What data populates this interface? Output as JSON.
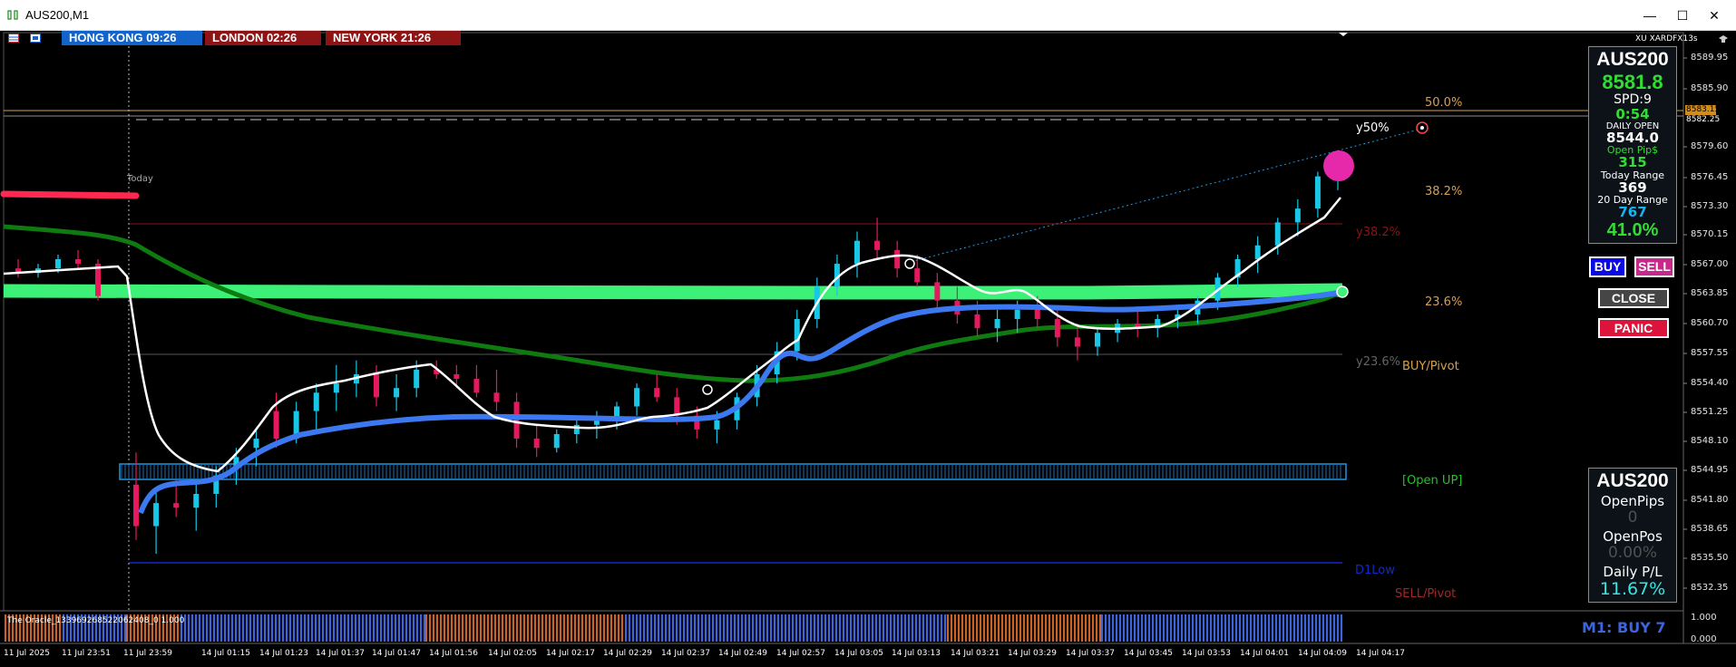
{
  "window": {
    "title": "AUS200,M1",
    "minimize": "—",
    "maximize": "☐",
    "close": "✕"
  },
  "sessions": [
    {
      "label": "HONG KONG 09:26",
      "color": "#1463c8"
    },
    {
      "label": "LONDON  02:26",
      "color": "#8c1414"
    },
    {
      "label": "NEW YORK  21:26",
      "color": "#8c1414"
    }
  ],
  "broker_label": "XU XARDFX13s",
  "info_panel": {
    "symbol": "AUS200",
    "price": "8581.8",
    "spread": "SPD:9",
    "timer": "0:54",
    "daily_open_label": "DAILY OPEN",
    "daily_open": "8544.0",
    "open_pips_label": "Open Pip$",
    "open_pips": "315",
    "today_range_label": "Today Range",
    "today_range": "369",
    "day20_range_label": "20 Day Range",
    "day20_range": "767",
    "ratio": "41.0%"
  },
  "buttons": {
    "buy": "BUY",
    "sell": "SELL",
    "close": "CLOSE",
    "panic": "PANIC"
  },
  "pos_panel": {
    "symbol": "AUS200",
    "open_pips_label": "OpenPips",
    "open_pips": "0",
    "open_pos_label": "OpenPos",
    "open_pos": "0.00%",
    "daily_pl_label": "Daily P/L",
    "daily_pl": "11.67%"
  },
  "fib_labels": {
    "f50": "50.0%",
    "y50": "y50%",
    "f382": "38.2%",
    "y382": "y38.2%",
    "f236": "23.6%",
    "y236": "y23.6%",
    "buy_pivot": "BUY/Pivot",
    "open_up": "[Open UP]",
    "d1low": "D1Low",
    "sell_pivot": "SELL/Pivot",
    "today": "Today"
  },
  "indicator": {
    "name": "The Oracle_133969268522062408_0 1.000",
    "signal": "M1: BUY 7"
  },
  "price_axis": [
    "8589.95",
    "8585.90",
    "8579.60",
    "8576.45",
    "8573.30",
    "8570.15",
    "8567.00",
    "8563.85",
    "8560.70",
    "8557.55",
    "8554.40",
    "8551.25",
    "8548.10",
    "8544.95",
    "8541.80",
    "8538.65",
    "8535.50",
    "8532.35"
  ],
  "price_markers": {
    "upper": "8583.15",
    "lower": "8582.25"
  },
  "ind_axis": [
    "1.000",
    "0.000"
  ],
  "time_axis": [
    "11 Jul 2025",
    "11 Jul 23:51",
    "11 Jul 23:59",
    "14 Jul 01:15",
    "14 Jul 01:23",
    "14 Jul 01:37",
    "14 Jul 01:47",
    "14 Jul 01:56",
    "14 Jul 02:05",
    "14 Jul 02:17",
    "14 Jul 02:29",
    "14 Jul 02:37",
    "14 Jul 02:49",
    "14 Jul 02:57",
    "14 Jul 03:05",
    "14 Jul 03:13",
    "14 Jul 03:21",
    "14 Jul 03:29",
    "14 Jul 03:37",
    "14 Jul 03:45",
    "14 Jul 03:53",
    "14 Jul 04:01",
    "14 Jul 04:09",
    "14 Jul 04:17"
  ],
  "colors": {
    "bull": "#19c6e6",
    "bear": "#e6195f",
    "green_band": "#3cf078",
    "dark_green": "#0f7a0f",
    "blue_ma": "#3c78f0",
    "white_ma": "#ffffff",
    "red_line": "#ff2850",
    "ind_blue": "#3c64dc",
    "ind_orange": "#c86428",
    "fib_orange": "#d7a050"
  },
  "chart_data": {
    "type": "candlestick",
    "symbol": "AUS200",
    "timeframe": "M1",
    "fib_levels": {
      "50.0%": 8583.15,
      "38.2%": 8573.3,
      "23.6%": 8563.85
    },
    "candles": [
      [
        8566.5,
        8567.5,
        8565.5,
        8566.0
      ],
      [
        8566.0,
        8567.0,
        8565.5,
        8566.5
      ],
      [
        8566.5,
        8568.0,
        8566.0,
        8567.5
      ],
      [
        8567.5,
        8568.5,
        8566.5,
        8567.0
      ],
      [
        8567.0,
        8567.5,
        8563.0,
        8563.5
      ],
      [
        8543.0,
        8546.5,
        8537.0,
        8538.5
      ],
      [
        8538.5,
        8542.5,
        8535.5,
        8541.0
      ],
      [
        8541.0,
        8543.5,
        8539.5,
        8540.5
      ],
      [
        8540.5,
        8543.0,
        8538.0,
        8542.0
      ],
      [
        8542.0,
        8545.0,
        8540.5,
        8544.0
      ],
      [
        8545.0,
        8547.0,
        8543.0,
        8546.0
      ],
      [
        8547.0,
        8549.0,
        8545.0,
        8548.0
      ],
      [
        8551.0,
        8553.0,
        8547.0,
        8548.0
      ],
      [
        8548.0,
        8552.0,
        8547.5,
        8551.0
      ],
      [
        8551.0,
        8554.0,
        8549.0,
        8553.0
      ],
      [
        8553.0,
        8556.0,
        8551.0,
        8554.0
      ],
      [
        8554.0,
        8556.5,
        8552.5,
        8555.0
      ],
      [
        8555.0,
        8556.0,
        8551.5,
        8552.5
      ],
      [
        8552.5,
        8555.0,
        8551.0,
        8553.5
      ],
      [
        8553.5,
        8556.5,
        8552.5,
        8555.5
      ],
      [
        8555.5,
        8556.5,
        8554.5,
        8555.0
      ],
      [
        8555.0,
        8556.0,
        8553.5,
        8554.5
      ],
      [
        8554.5,
        8556.0,
        8552.5,
        8553.0
      ],
      [
        8553.0,
        8555.5,
        8551.0,
        8552.0
      ],
      [
        8552.0,
        8553.0,
        8547.0,
        8548.0
      ],
      [
        8548.0,
        8549.5,
        8546.0,
        8547.0
      ],
      [
        8547.0,
        8549.0,
        8546.5,
        8548.5
      ],
      [
        8548.5,
        8550.5,
        8547.5,
        8549.5
      ],
      [
        8549.5,
        8551.0,
        8548.0,
        8550.0
      ],
      [
        8550.0,
        8552.0,
        8549.0,
        8551.5
      ],
      [
        8551.5,
        8554.0,
        8550.5,
        8553.5
      ],
      [
        8553.5,
        8555.0,
        8552.0,
        8552.5
      ],
      [
        8552.5,
        8553.5,
        8549.5,
        8550.5
      ],
      [
        8550.5,
        8551.5,
        8548.0,
        8549.0
      ],
      [
        8549.0,
        8551.0,
        8547.5,
        8550.0
      ],
      [
        8550.0,
        8553.0,
        8549.0,
        8552.5
      ],
      [
        8552.5,
        8556.0,
        8551.5,
        8555.0
      ],
      [
        8555.0,
        8558.5,
        8554.0,
        8557.5
      ],
      [
        8557.5,
        8562.0,
        8556.5,
        8561.0
      ],
      [
        8561.0,
        8565.5,
        8560.0,
        8564.5
      ],
      [
        8564.5,
        8568.0,
        8563.5,
        8567.0
      ],
      [
        8567.0,
        8570.5,
        8565.5,
        8569.5
      ],
      [
        8569.5,
        8572.0,
        8567.5,
        8568.5
      ],
      [
        8568.5,
        8569.5,
        8565.5,
        8566.5
      ],
      [
        8566.5,
        8568.0,
        8564.5,
        8565.0
      ],
      [
        8565.0,
        8566.0,
        8562.0,
        8563.0
      ],
      [
        8563.0,
        8564.5,
        8560.5,
        8561.5
      ],
      [
        8561.5,
        8563.0,
        8559.0,
        8560.0
      ],
      [
        8560.0,
        8562.0,
        8558.5,
        8561.0
      ],
      [
        8561.0,
        8563.0,
        8559.5,
        8562.0
      ],
      [
        8562.0,
        8563.5,
        8560.0,
        8561.0
      ],
      [
        8561.0,
        8562.0,
        8558.0,
        8559.0
      ],
      [
        8559.0,
        8560.5,
        8556.5,
        8558.0
      ],
      [
        8558.0,
        8560.0,
        8557.0,
        8559.5
      ],
      [
        8559.5,
        8561.0,
        8558.5,
        8560.5
      ],
      [
        8560.5,
        8562.0,
        8559.0,
        8560.0
      ],
      [
        8560.0,
        8561.5,
        8559.0,
        8561.0
      ],
      [
        8561.0,
        8562.5,
        8560.0,
        8561.5
      ],
      [
        8561.5,
        8563.5,
        8560.5,
        8563.0
      ],
      [
        8563.0,
        8566.0,
        8562.0,
        8565.5
      ],
      [
        8565.5,
        8568.0,
        8564.5,
        8567.5
      ],
      [
        8567.5,
        8570.0,
        8566.0,
        8569.0
      ],
      [
        8569.0,
        8572.0,
        8568.0,
        8571.5
      ],
      [
        8571.5,
        8574.0,
        8570.0,
        8573.0
      ],
      [
        8573.0,
        8577.0,
        8572.0,
        8576.5
      ],
      [
        8576.5,
        8578.0,
        8575.0,
        8577.5
      ]
    ]
  }
}
